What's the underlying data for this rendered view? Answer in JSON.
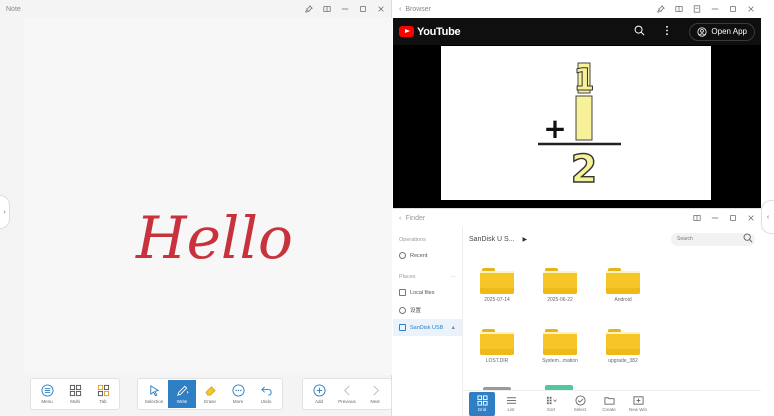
{
  "note": {
    "title": "Note",
    "canvas_text": "Hello",
    "ink_color": "#c8323c",
    "toolbar_left": [
      {
        "label": "Menu",
        "icon": "menu-icon"
      },
      {
        "label": "Multi",
        "icon": "grid-icon"
      },
      {
        "label": "Tab",
        "icon": "template-icon"
      }
    ],
    "toolbar_center": [
      {
        "label": "Selection",
        "icon": "cursor-icon"
      },
      {
        "label": "Write",
        "icon": "pen-icon"
      },
      {
        "label": "Erase",
        "icon": "eraser-icon"
      },
      {
        "label": "More",
        "icon": "more-icon"
      },
      {
        "label": "Undo",
        "icon": "undo-icon"
      }
    ],
    "toolbar_right": [
      {
        "label": "Add",
        "icon": "plus-circle-icon"
      },
      {
        "label": "Previous",
        "icon": "chevron-left-icon"
      },
      {
        "label": "Next",
        "icon": "chevron-right-icon"
      }
    ]
  },
  "browser": {
    "title": "Browser",
    "site": "YouTube",
    "open_app_label": "Open App",
    "video_frame": {
      "top": "1",
      "operator": "+",
      "bottom": "2"
    }
  },
  "finder": {
    "title": "Finder",
    "sections": {
      "recent_label": "Operations",
      "places_label": "Places",
      "places_more": "···"
    },
    "recent_item": "Recent",
    "places": [
      {
        "label": "Local files",
        "active": false
      },
      {
        "label": "设置",
        "active": false
      },
      {
        "label": "SanDisk USB",
        "active": true
      }
    ],
    "path": "SanDisk U S...",
    "search_placeholder": "Search",
    "folders": [
      "2025-07-14",
      "2025-06-22",
      "Android",
      "LOST.DIR",
      "System...mation",
      "upgrade_382"
    ],
    "bottom_tools": [
      {
        "label": "Grid",
        "icon": "grid-view-icon",
        "active": true
      },
      {
        "label": "List",
        "icon": "list-view-icon",
        "active": false
      },
      {
        "label": "Sort",
        "icon": "sort-icon",
        "active": false
      },
      {
        "label": "Select",
        "icon": "check-circle-icon",
        "active": false
      },
      {
        "label": "Create",
        "icon": "new-folder-icon",
        "active": false
      },
      {
        "label": "New Win",
        "icon": "new-window-icon",
        "active": false
      }
    ]
  },
  "colors": {
    "accent": "#2e7fc3",
    "folder": "#f6c628",
    "yt_red": "#ff0000",
    "math_fill": "#f7f29a"
  }
}
